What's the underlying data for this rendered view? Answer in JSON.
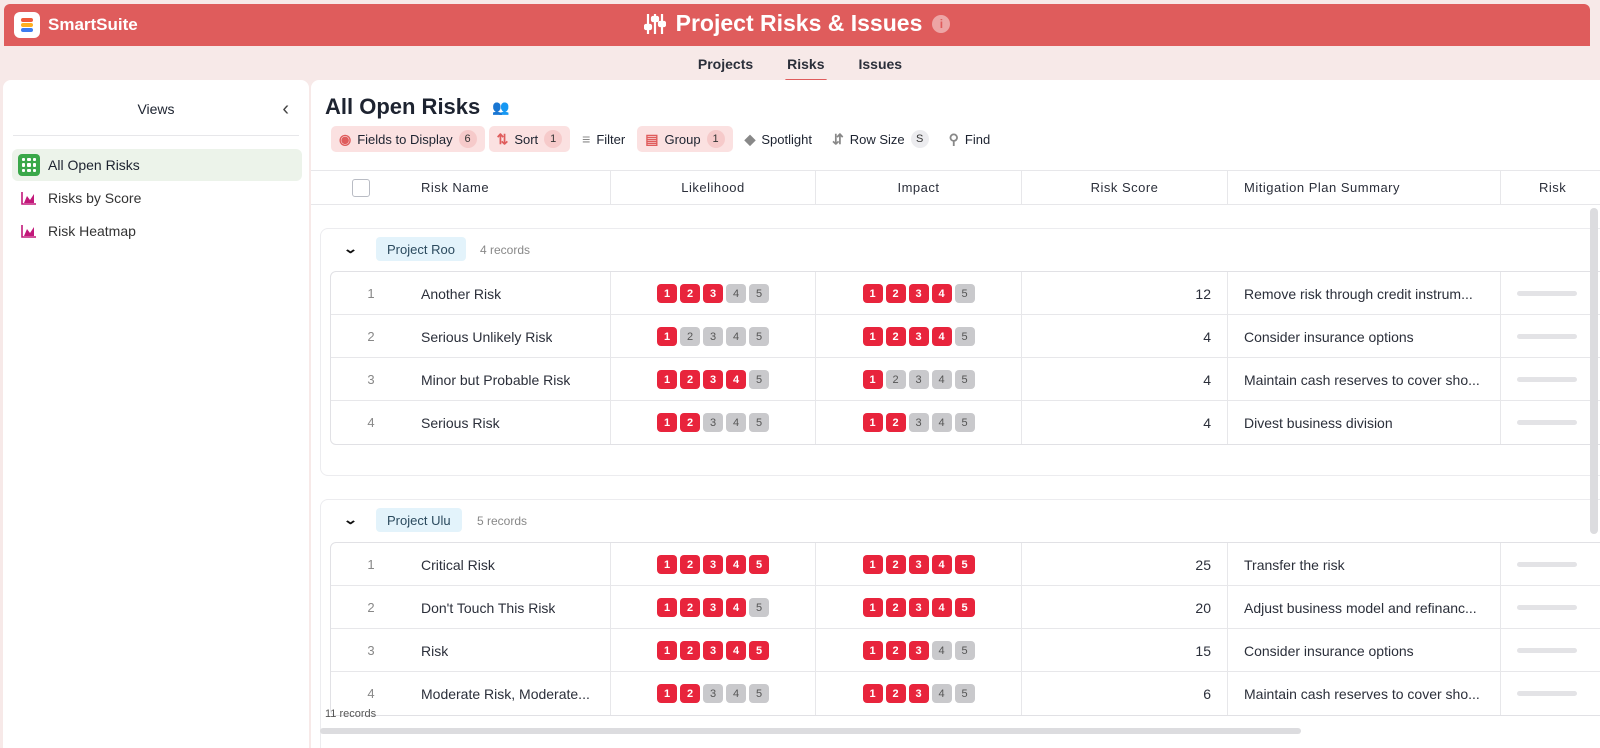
{
  "brand": {
    "name": "SmartSuite"
  },
  "app": {
    "title": "Project Risks & Issues"
  },
  "tabs": [
    {
      "label": "Projects"
    },
    {
      "label": "Risks"
    },
    {
      "label": "Issues"
    }
  ],
  "sidebar": {
    "title": "Views",
    "items": [
      {
        "label": "All Open Risks"
      },
      {
        "label": "Risks by Score"
      },
      {
        "label": "Risk Heatmap"
      }
    ]
  },
  "view": {
    "title": "All Open Risks"
  },
  "toolbar": {
    "fields_label": "Fields to Display",
    "fields_count": "6",
    "sort_label": "Sort",
    "sort_count": "1",
    "filter_label": "Filter",
    "group_label": "Group",
    "group_count": "1",
    "spotlight_label": "Spotlight",
    "rowsize_label": "Row Size",
    "rowsize_value": "S",
    "find_label": "Find"
  },
  "columns": {
    "name": "Risk Name",
    "likelihood": "Likelihood",
    "impact": "Impact",
    "score": "Risk Score",
    "mitigation": "Mitigation Plan Summary",
    "extra": "Risk"
  },
  "groups": [
    {
      "label": "Project Roo",
      "count": "4 records",
      "rows": [
        {
          "idx": "1",
          "name": "Another Risk",
          "likelihood": 3,
          "impact": 4,
          "score": "12",
          "mitigation": "Remove risk through credit instrum..."
        },
        {
          "idx": "2",
          "name": "Serious Unlikely Risk",
          "likelihood": 1,
          "impact": 4,
          "score": "4",
          "mitigation": "Consider insurance options"
        },
        {
          "idx": "3",
          "name": "Minor but Probable Risk",
          "likelihood": 4,
          "impact": 1,
          "score": "4",
          "mitigation": "Maintain cash reserves to cover sho..."
        },
        {
          "idx": "4",
          "name": "Serious Risk",
          "likelihood": 2,
          "impact": 2,
          "score": "4",
          "mitigation": "Divest business division"
        }
      ]
    },
    {
      "label": "Project Ulu",
      "count": "5 records",
      "rows": [
        {
          "idx": "1",
          "name": "Critical Risk",
          "likelihood": 5,
          "impact": 5,
          "score": "25",
          "mitigation": "Transfer the risk"
        },
        {
          "idx": "2",
          "name": "Don't Touch This Risk",
          "likelihood": 4,
          "impact": 5,
          "score": "20",
          "mitigation": "Adjust business model and refinanc..."
        },
        {
          "idx": "3",
          "name": "Risk",
          "likelihood": 5,
          "impact": 3,
          "score": "15",
          "mitigation": "Consider insurance options"
        },
        {
          "idx": "4",
          "name": "Moderate Risk, Moderate...",
          "likelihood": 2,
          "impact": 3,
          "score": "6",
          "mitigation": "Maintain cash reserves to cover sho..."
        }
      ]
    }
  ],
  "footer": {
    "records": "11 records"
  },
  "colors": {
    "header": "#df5c5c",
    "rating_on": "#e8243c",
    "rating_off": "#c9c9cc",
    "active_view": "#3aa84a"
  }
}
